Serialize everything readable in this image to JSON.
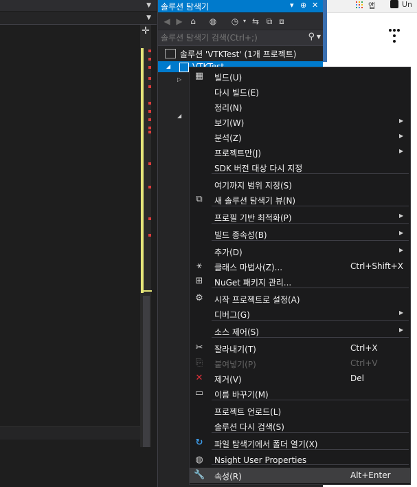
{
  "solution_explorer": {
    "title": "솔루션 탐색기",
    "title_controls": {
      "dropdown": "▾",
      "pin": "⊕",
      "close": "✕"
    },
    "search_placeholder": "솔루션 탐색기 검색(Ctrl+;)",
    "tree": {
      "solution": "솔루션 'VTKTest' (1개 프로젝트)",
      "project": "VTKTest"
    }
  },
  "browser": {
    "tab_text": "Un",
    "tab_text2": "앱"
  },
  "context_menu": {
    "items": [
      {
        "label": "빌드(U)",
        "icon": "build-icon",
        "glyph": "▦"
      },
      {
        "label": "다시 빌드(E)"
      },
      {
        "label": "정리(N)"
      },
      {
        "label": "보기(W)",
        "submenu": true
      },
      {
        "label": "분석(Z)",
        "submenu": true
      },
      {
        "label": "프로젝트만(J)",
        "submenu": true
      },
      {
        "label": "SDK 버전 대상 다시 지정"
      },
      {
        "label": "여기까지 범위 지정(S)"
      },
      {
        "label": "새 솔루션 탐색기 뷰(N)",
        "icon": "new-view-icon",
        "glyph": "⧉"
      },
      {
        "label": "프로필 기반 최적화(P)",
        "submenu": true
      },
      {
        "label": "빌드 종속성(B)",
        "submenu": true
      },
      {
        "label": "추가(D)",
        "submenu": true
      },
      {
        "label": "클래스 마법사(Z)...",
        "shortcut": "Ctrl+Shift+X",
        "icon": "class-wizard-icon",
        "glyph": "⚹"
      },
      {
        "label": "NuGet 패키지 관리...",
        "icon": "nuget-icon",
        "glyph": "⊞"
      },
      {
        "label": "시작 프로젝트로 설정(A)",
        "icon": "gear-icon",
        "glyph": "⚙"
      },
      {
        "label": "디버그(G)",
        "submenu": true
      },
      {
        "label": "소스 제어(S)",
        "submenu": true
      },
      {
        "label": "잘라내기(T)",
        "shortcut": "Ctrl+X",
        "icon": "scissors-icon",
        "glyph": "✂"
      },
      {
        "label": "붙여넣기(P)",
        "shortcut": "Ctrl+V",
        "disabled": true,
        "icon": "paste-icon",
        "glyph": "⎘"
      },
      {
        "label": "제거(V)",
        "shortcut": "Del",
        "icon": "remove-icon",
        "glyph": "✕"
      },
      {
        "label": "이름 바꾸기(M)",
        "icon": "rename-icon",
        "glyph": "▭"
      },
      {
        "label": "프로젝트 언로드(L)"
      },
      {
        "label": "솔루션 다시 검색(S)"
      },
      {
        "label": "파일 탐색기에서 폴더 열기(X)",
        "icon": "refresh-folder-icon",
        "glyph": "↻"
      },
      {
        "label": "Nsight User Properties",
        "icon": "globe-icon",
        "glyph": "◍"
      },
      {
        "label": "속성(R)",
        "shortcut": "Alt+Enter",
        "icon": "wrench-icon",
        "glyph": "🔧",
        "highlighted": true
      }
    ]
  },
  "colors": {
    "accent": "#007acc",
    "remove_icon": "#e0303a",
    "open_folder_icon": "#3c9be8"
  }
}
